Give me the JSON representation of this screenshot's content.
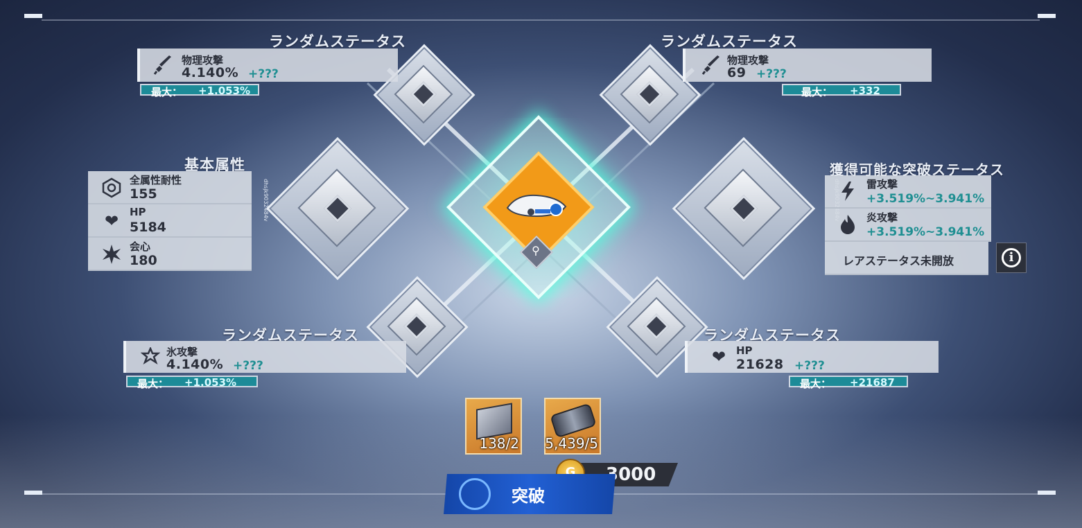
{
  "slots": {
    "top_left": {
      "title": "ランダムステータス",
      "stat_name": "物理攻撃",
      "value": "4.140%",
      "plus": "+???",
      "max_label": "最大：",
      "max_value": "+1.053%"
    },
    "top_right": {
      "title": "ランダムステータス",
      "stat_name": "物理攻撃",
      "value": "69",
      "plus": "+???",
      "max_label": "最大：",
      "max_value": "+332"
    },
    "bottom_left": {
      "title": "ランダムステータス",
      "stat_name": "氷攻撃",
      "value": "4.140%",
      "plus": "+???",
      "max_label": "最大：",
      "max_value": "+1.053%"
    },
    "bottom_right": {
      "title": "ランダムステータス",
      "stat_name": "HP",
      "value": "21628",
      "plus": "+???",
      "max_label": "最大：",
      "max_value": "+21687"
    }
  },
  "base_attributes": {
    "title": "基本属性",
    "side_code": "dhsjk9032484v",
    "items": [
      {
        "name": "全属性耐性",
        "value": "155",
        "icon": "hexagon-resistance-icon"
      },
      {
        "name": "HP",
        "value": "5184",
        "icon": "heart-icon"
      },
      {
        "name": "会心",
        "value": "180",
        "icon": "burst-icon"
      }
    ]
  },
  "breakthrough_stats": {
    "title": "獲得可能な突破ステータス",
    "side_code": "dhsjk9032484v",
    "items": [
      {
        "name": "雷攻撃",
        "value": "+3.519%~3.941%",
        "icon": "lightning-icon"
      },
      {
        "name": "炎攻撃",
        "value": "+3.519%~3.941%",
        "icon": "flame-icon"
      }
    ],
    "rare_label": "レアステータス未開放"
  },
  "materials": [
    {
      "count": "138/2",
      "icon": "cube-material-icon"
    },
    {
      "count": "5,439/5",
      "icon": "battery-material-icon"
    }
  ],
  "cost": {
    "amount": "3000",
    "icon": "gold-coin-icon"
  },
  "action": {
    "label": "突破"
  },
  "colors": {
    "accent_teal": "#1d8b98",
    "plus_teal": "#1f8f92",
    "button_blue": "#1d4fb8",
    "center_orange": "#f29a18"
  }
}
